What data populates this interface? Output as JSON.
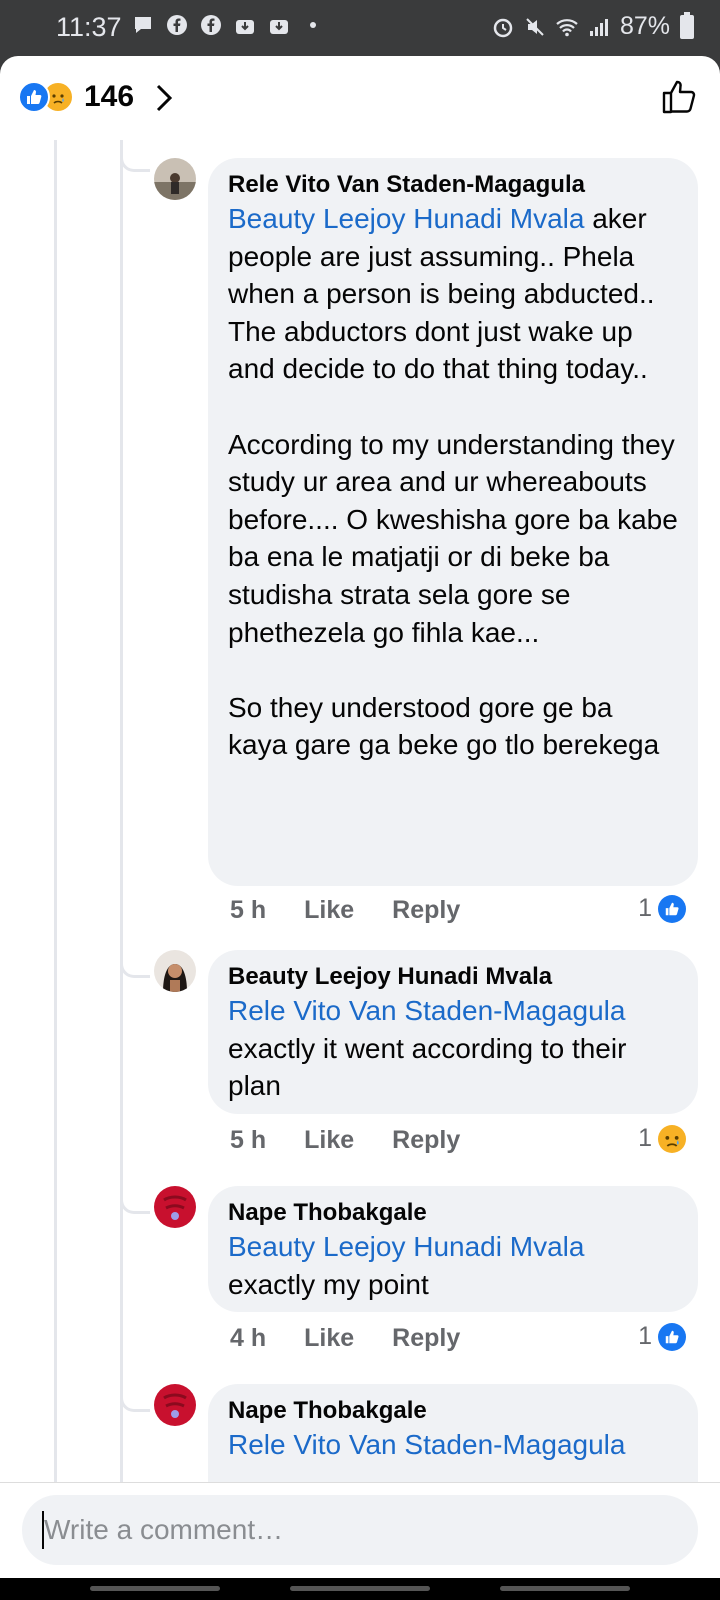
{
  "status_bar": {
    "time": "11:37",
    "battery": "87%"
  },
  "header": {
    "reaction_count": "146"
  },
  "comments": [
    {
      "author": "Rele Vito Van Staden-Magagula",
      "mention": "Beauty Leejoy Hunadi Mvala",
      "text": " aker people are just assuming.. Phela when a person is being abducted.. The abductors dont just wake up and decide to do that thing today..\n\nAccording to my understanding they study ur area and ur whereabouts before.... O kweshisha gore ba kabe ba ena le matjatji or di beke ba studisha strata sela gore se phethezela go fihla kae...\n\nSo they understood gore ge ba kaya gare ga beke go tlo berekega",
      "time": "5 h",
      "like_label": "Like",
      "reply_label": "Reply",
      "reaction_count": "1",
      "reaction_icon": "like"
    },
    {
      "author": "Beauty Leejoy Hunadi Mvala",
      "mention": "Rele Vito Van Staden-Magagula",
      "text": "\nexactly it went according to their plan",
      "time": "5 h",
      "like_label": "Like",
      "reply_label": "Reply",
      "reaction_count": "1",
      "reaction_icon": "sad"
    },
    {
      "author": "Nape Thobakgale",
      "mention": "Beauty Leejoy Hunadi Mvala",
      "text": "\nexactly my point",
      "time": "4 h",
      "like_label": "Like",
      "reply_label": "Reply",
      "reaction_count": "1",
      "reaction_icon": "like"
    },
    {
      "author": "Nape Thobakgale",
      "mention": "Rele Vito Van Staden-Magagula",
      "text": ""
    }
  ],
  "composer": {
    "placeholder": "Write a comment…"
  },
  "colors": {
    "link": "#1b6ac9",
    "bubble": "#f0f2f5",
    "like_blue": "#1877f2",
    "sad_yellow": "#f7b125"
  }
}
